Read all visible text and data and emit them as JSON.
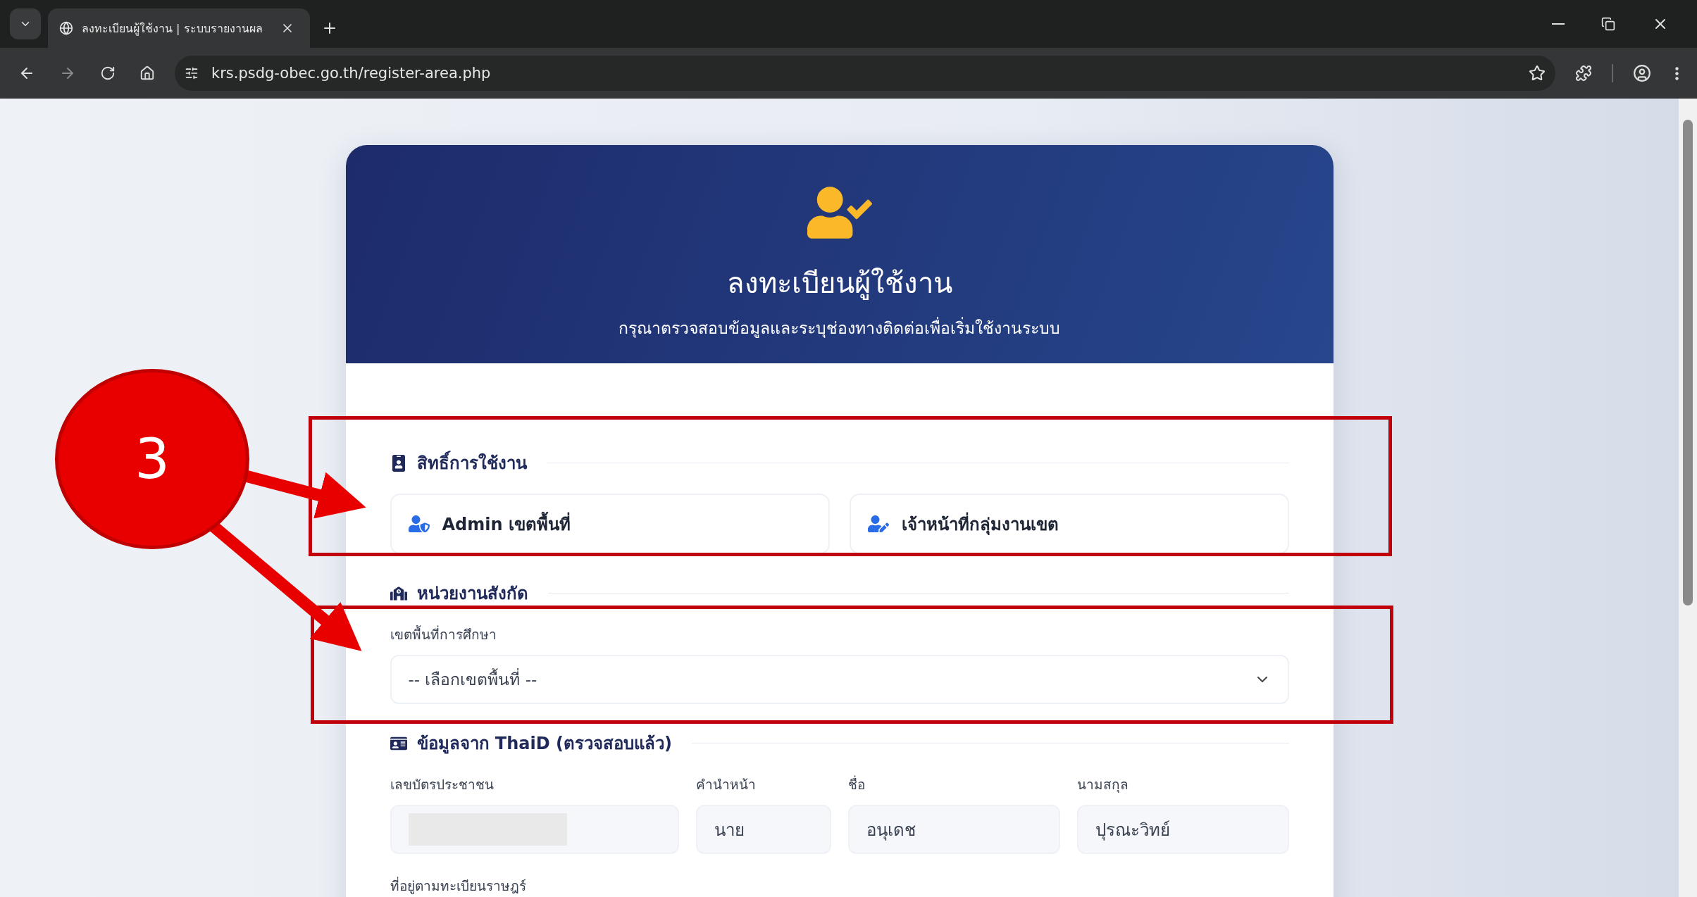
{
  "browser": {
    "tab_title": "ลงทะเบียนผู้ใช้งาน | ระบบรายงานผล",
    "url": "krs.psdg-obec.go.th/register-area.php"
  },
  "header": {
    "title": "ลงทะเบียนผู้ใช้งาน",
    "subtitle": "กรุณาตรวจสอบข้อมูลและระบุช่องทางติดต่อเพื่อเริ่มใช้งานระบบ"
  },
  "sections": [
    {
      "kind": "roles",
      "title": "สิทธิ์การใช้งาน",
      "options": [
        {
          "label": "Admin เขตพื้นที่",
          "selected": false
        },
        {
          "label": "เจ้าหน้าที่กลุ่มงานเขต",
          "selected": false
        }
      ]
    },
    {
      "kind": "select",
      "title": "หน่วยงานสังกัด",
      "field": {
        "label": "เขตพื้นที่การศึกษา",
        "placeholder": "-- เลือกเขตพื้นที่ --"
      }
    },
    {
      "kind": "fields",
      "title": "ข้อมูลจาก ThaiD (ตรวจสอบแล้ว)",
      "fields": [
        {
          "label": "เลขบัตรประชาชน",
          "redacted": true
        },
        {
          "label": "คำนำหน้า",
          "value": "นาย"
        },
        {
          "label": "ชื่อ",
          "value": "อนุเดช"
        },
        {
          "label": "นามสกุล",
          "value": "ปุรณะวิทย์"
        }
      ],
      "next_label": "ที่อยู่ตามทะเบียนราษฎร์"
    }
  ],
  "annotation": {
    "step": "3"
  }
}
